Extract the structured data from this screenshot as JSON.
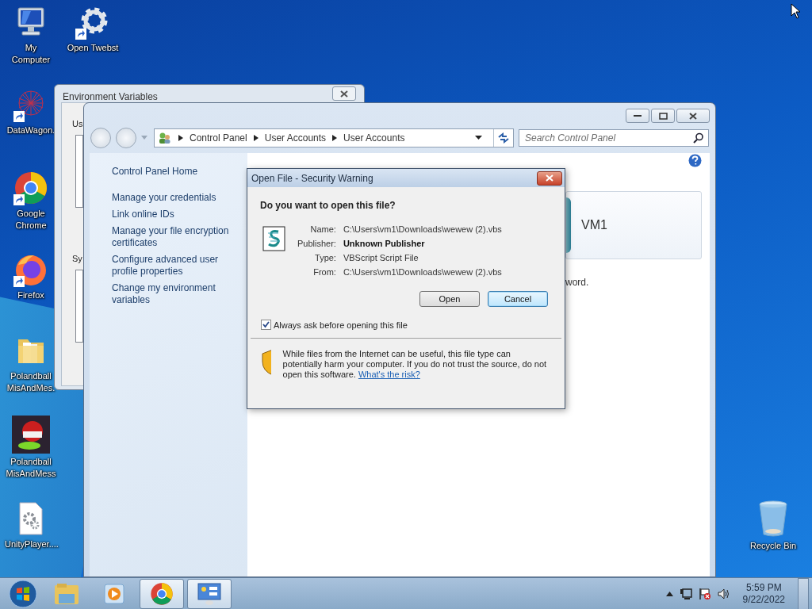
{
  "desktop_icons": [
    {
      "label": "My Computer",
      "kind": "computer",
      "shortcut": false
    },
    {
      "label": "Open Twebst",
      "kind": "gear",
      "shortcut": true
    },
    {
      "label": "DataWagon.",
      "kind": "mesh",
      "shortcut": true
    },
    {
      "label": "Google Chrome",
      "kind": "chrome",
      "shortcut": true
    },
    {
      "label": "Firefox",
      "kind": "firefox",
      "shortcut": true
    },
    {
      "label": "Polandball MisAndMes.",
      "kind": "folder",
      "shortcut": false
    },
    {
      "label": "Polandball MisAndMess",
      "kind": "game",
      "shortcut": false
    },
    {
      "label": "UnityPlayer....",
      "kind": "file",
      "shortcut": false
    },
    {
      "label": "Recycle Bin",
      "kind": "recycle",
      "shortcut": false
    }
  ],
  "background_window": {
    "title": "Environment Variables",
    "section_labels": [
      "Us",
      "Sy"
    ]
  },
  "control_panel": {
    "breadcrumbs": [
      "Control Panel",
      "User Accounts",
      "User Accounts"
    ],
    "search": {
      "placeholder": "Search Control Panel"
    },
    "sidebar_links": [
      "Control Panel Home",
      "Manage your credentials",
      "Link online IDs",
      "Manage your file encryption certificates",
      "Configure advanced user profile properties",
      "Change my environment variables"
    ],
    "account_name": "VM1",
    "text_fragment": "word."
  },
  "dialog": {
    "title": "Open File - Security Warning",
    "heading": "Do you want to open this file?",
    "fields": [
      {
        "label": "Name:",
        "value": "C:\\Users\\vm1\\Downloads\\wewew (2).vbs",
        "bold": false
      },
      {
        "label": "Publisher:",
        "value": "Unknown Publisher",
        "bold": true
      },
      {
        "label": "Type:",
        "value": "VBScript Script File",
        "bold": false
      },
      {
        "label": "From:",
        "value": "C:\\Users\\vm1\\Downloads\\wewew (2).vbs",
        "bold": false
      }
    ],
    "buttons": [
      {
        "label": "Open",
        "default": false
      },
      {
        "label": "Cancel",
        "default": true
      }
    ],
    "checkbox": {
      "label": "Always ask before opening this file",
      "checked": true
    },
    "warning": {
      "text": "While files from the Internet can be useful, this file type can potentially harm your computer. If you do not trust the source, do not open this software.",
      "link": "What's the risk?"
    }
  },
  "taskbar": {
    "items": [
      {
        "kind": "start",
        "active": false
      },
      {
        "kind": "folder",
        "active": false
      },
      {
        "kind": "media",
        "active": false
      },
      {
        "kind": "chrome",
        "active": true
      },
      {
        "kind": "control-panel",
        "active": true
      }
    ],
    "clock": {
      "time": "5:59 PM",
      "date": "9/22/2022"
    }
  }
}
